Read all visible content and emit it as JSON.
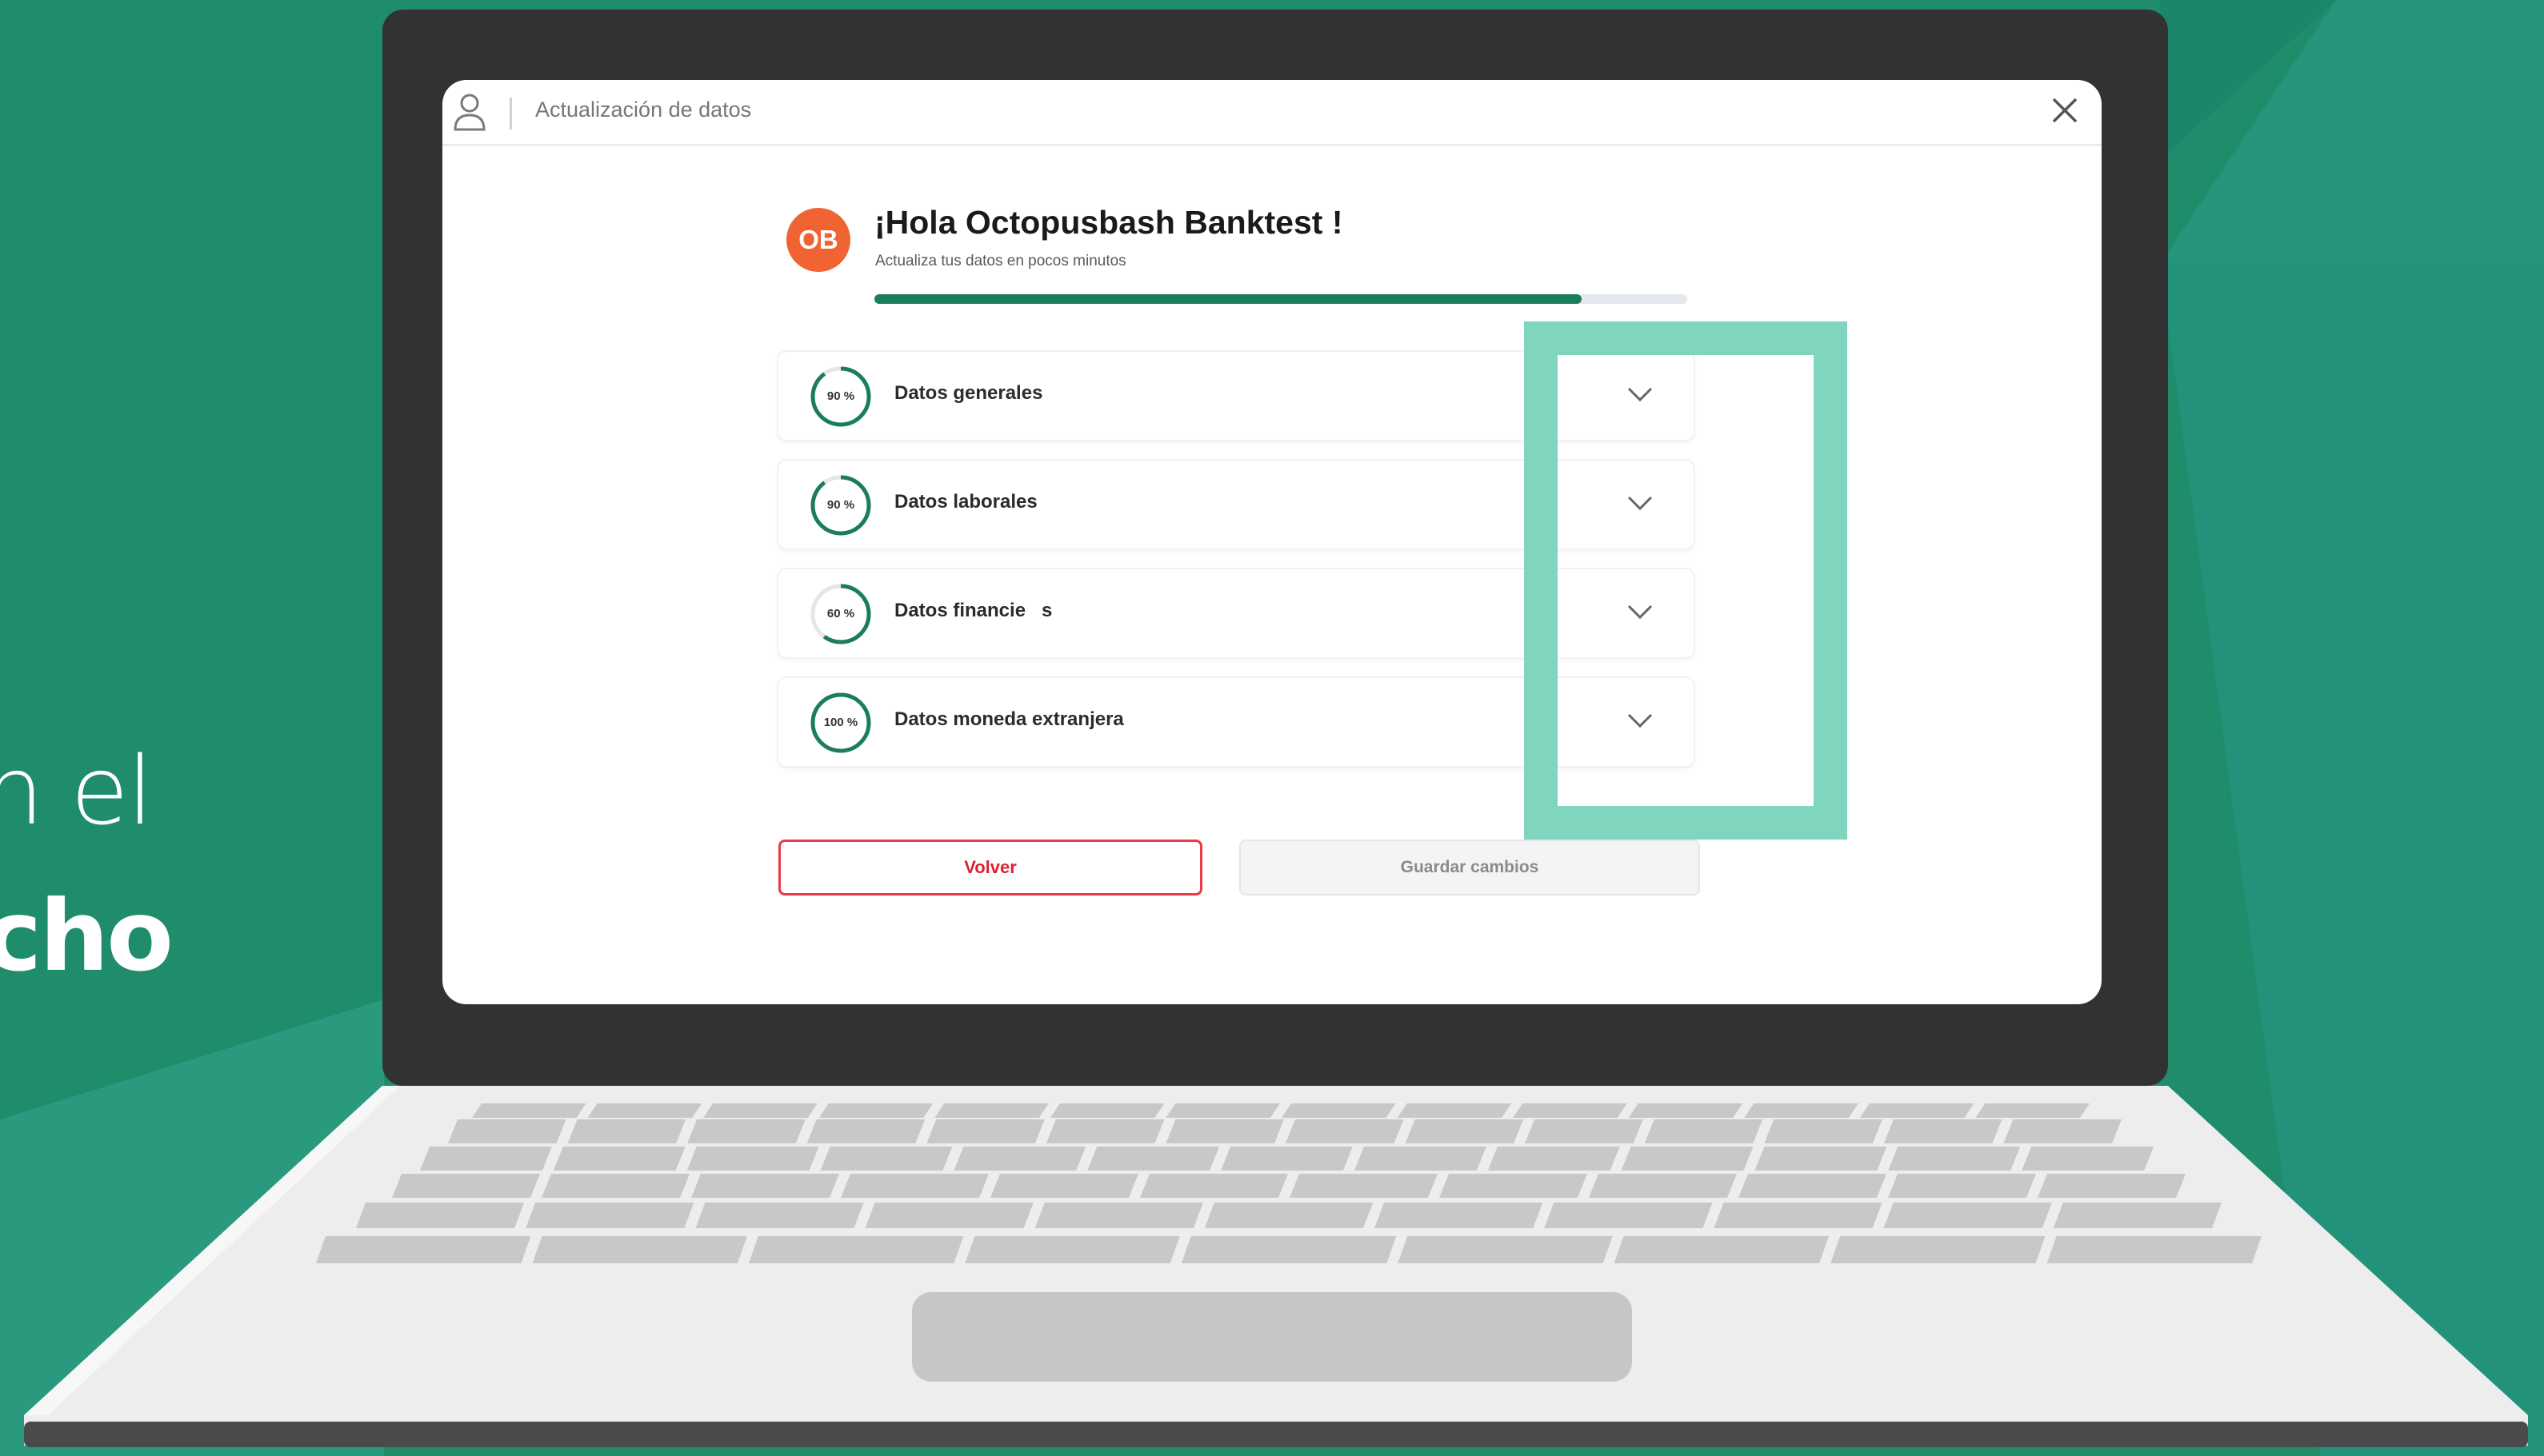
{
  "side_text": {
    "line1": "n el",
    "line2": "cho"
  },
  "window": {
    "title": "Actualización de datos",
    "icons": {
      "user": "user-icon",
      "close": "close-icon"
    }
  },
  "profile": {
    "initials": "OB",
    "greeting": "¡Hola Octopusbash Banktest !",
    "subtitle": "Actualiza tus datos en pocos minutos",
    "progress": 0.87
  },
  "sections": [
    {
      "label": "Datos generales",
      "percent_label": "90 %",
      "progress": 0.9
    },
    {
      "label": "Datos laborales",
      "percent_label": "90 %",
      "progress": 0.9
    },
    {
      "label": "Datos financie   s",
      "percent_label": "60 %",
      "progress": 0.6
    },
    {
      "label": "Datos moneda extranjera",
      "percent_label": "100 %",
      "progress": 1.0
    }
  ],
  "buttons": {
    "back": "Volver",
    "save": "Guardar cambios"
  },
  "colors": {
    "background": "#1f8c6c",
    "accent_green": "#1b7d5c",
    "highlight": "#7fd5bd",
    "avatar": "#f06332",
    "back_button": "#ea3b46"
  }
}
